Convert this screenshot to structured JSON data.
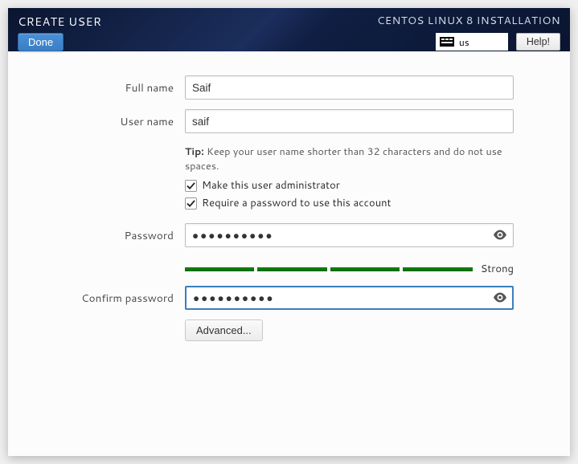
{
  "header": {
    "title": "CREATE USER",
    "done_label": "Done",
    "installer_title": "CENTOS LINUX 8 INSTALLATION",
    "keyboard_layout": "us",
    "help_label": "Help!"
  },
  "form": {
    "full_name_label": "Full name",
    "full_name_value": "Saif",
    "user_name_label": "User name",
    "user_name_value": "saif",
    "tip_label": "Tip:",
    "tip_text": " Keep your user name shorter than 32 characters and do not use spaces.",
    "admin_checkbox_label": "Make this user administrator",
    "admin_checked": true,
    "require_pw_checkbox_label": "Require a password to use this account",
    "require_pw_checked": true,
    "password_label": "Password",
    "password_value": "●●●●●●●●●●",
    "password_strength": "Strong",
    "confirm_password_label": "Confirm password",
    "confirm_password_value": "●●●●●●●●●●",
    "advanced_label": "Advanced..."
  }
}
